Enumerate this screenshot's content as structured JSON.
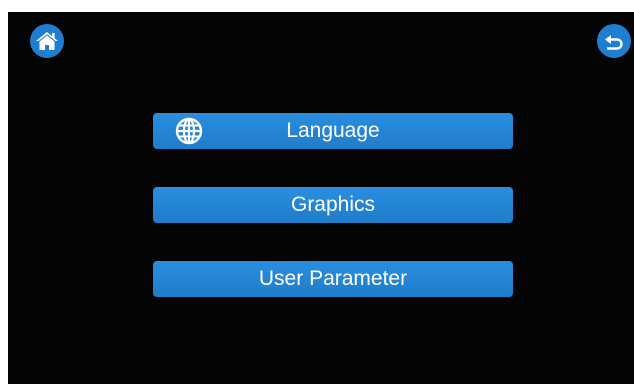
{
  "top_bar": {
    "home_icon": "home-icon",
    "back_icon": "back-arrow-icon",
    "accent_color": "#1e7fd0"
  },
  "menu": {
    "items": [
      {
        "label": "Language",
        "icon": "globe-icon"
      },
      {
        "label": "Graphics"
      },
      {
        "label": "User Parameter"
      }
    ],
    "button_color": "#2385d6",
    "background_color": "#050404"
  }
}
